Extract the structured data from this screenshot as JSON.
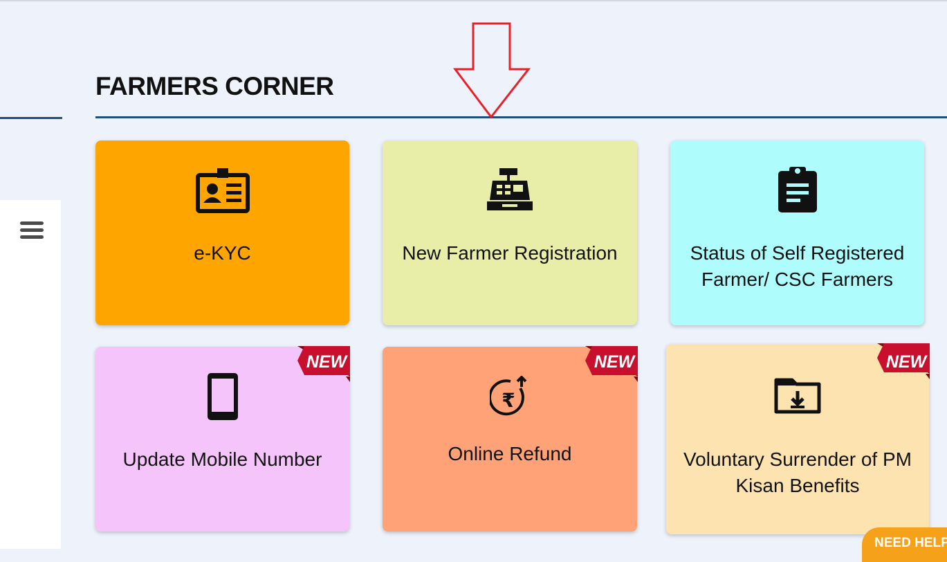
{
  "section": {
    "title": "FARMERS CORNER"
  },
  "cards": [
    {
      "label": "e-KYC",
      "icon": "id-card-icon",
      "color": "#ffa500",
      "new": false
    },
    {
      "label": "New Farmer Registration",
      "icon": "cash-register-icon",
      "color": "#e8eea7",
      "new": false
    },
    {
      "label": "Status of Self Registered Farmer/ CSC Farmers",
      "icon": "clipboard-icon",
      "color": "#aefcfc",
      "new": false
    },
    {
      "label": "Update Mobile Number",
      "icon": "mobile-phone-icon",
      "color": "#f5c4fa",
      "new": true
    },
    {
      "label": "Online Refund",
      "icon": "rupee-refund-icon",
      "color": "#ffa278",
      "new": true
    },
    {
      "label": "Voluntary Surrender of PM Kisan Benefits",
      "icon": "folder-download-icon",
      "color": "#fde3b0",
      "new": true
    }
  ],
  "badge": {
    "text": "NEW"
  },
  "help_button": {
    "label": "NEED HELP"
  },
  "annotation": {
    "arrow_color": "#e8202a"
  }
}
